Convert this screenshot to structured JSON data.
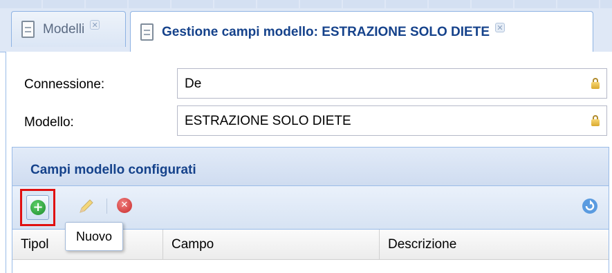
{
  "tabs": [
    {
      "label": "Modelli",
      "active": false
    },
    {
      "label": "Gestione campi modello: ESTRAZIONE SOLO DIETE",
      "active": true
    }
  ],
  "form": {
    "connection_label": "Connessione:",
    "connection_value": "De",
    "model_label": "Modello:",
    "model_value": "ESTRAZIONE SOLO DIETE"
  },
  "grid": {
    "title": "Campi modello configurati",
    "toolbar": {
      "add_tooltip": "Nuovo",
      "add_glyph": "+",
      "delete_glyph": "✕",
      "refresh_icon": "refresh-icon"
    },
    "columns": [
      "Tipol",
      "Campo",
      "Descrizione"
    ]
  },
  "colors": {
    "header_text": "#15428b",
    "highlight_border": "#e01010",
    "panel_border": "#99bbe8"
  }
}
